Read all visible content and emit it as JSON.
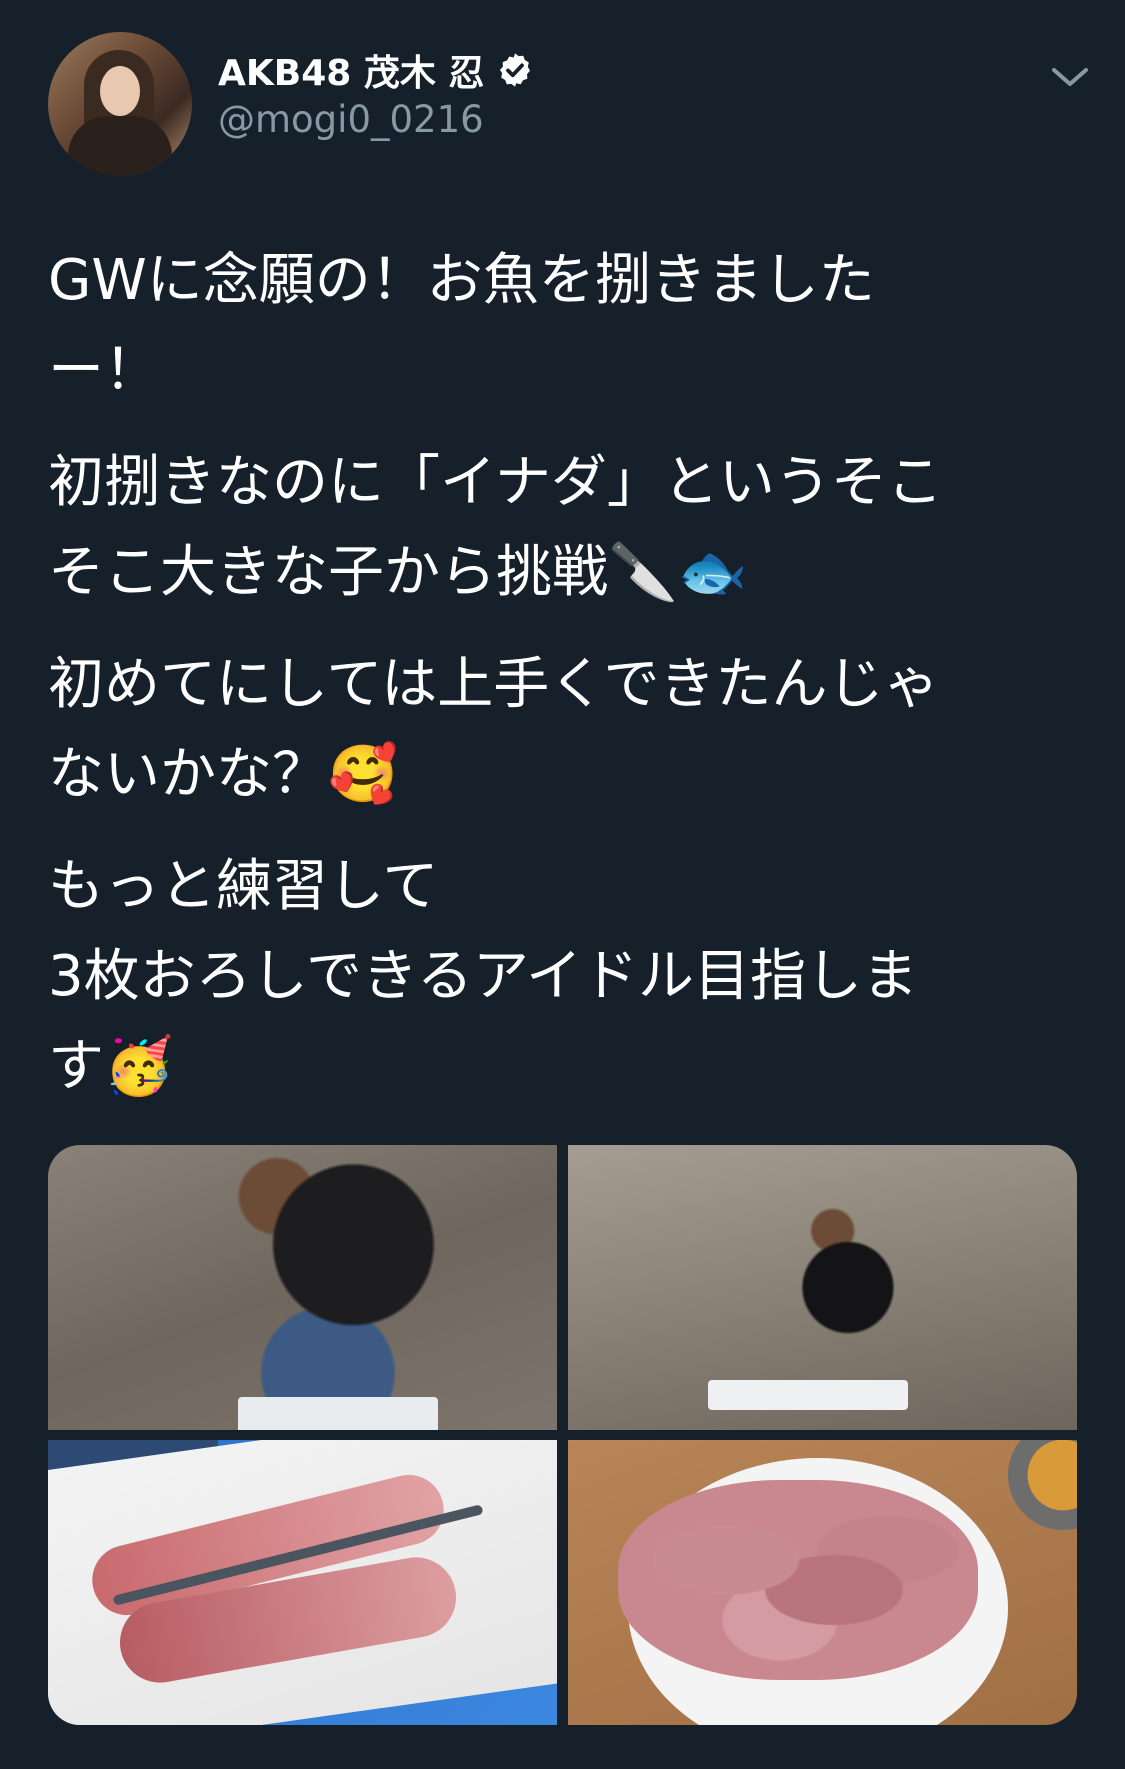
{
  "tweet": {
    "author": {
      "display_name": "AKB48 茂木 忍",
      "handle": "@mogi0_0216",
      "verified": true,
      "avatar_icon": "profile-photo"
    },
    "menu_icon": "chevron-down-icon",
    "text_paragraphs": [
      "GWに念願の！お魚を捌きました\nー！",
      "初捌きなのに「イナダ」というそこ\nそこ大きな子から挑戦🔪🐟",
      "初めてにしては上手くできたんじゃ\nないかな？🥰",
      "もっと練習して\n3枚おろしできるアイドル目指しま\nす🥳"
    ],
    "media": {
      "photos": [
        {
          "name": "photo-woman-cutting-fish-closeup"
        },
        {
          "name": "photo-woman-crouching-cutting-fish"
        },
        {
          "name": "photo-fish-fillets-on-board"
        },
        {
          "name": "photo-sashimi-on-plate"
        }
      ]
    }
  },
  "colors": {
    "background": "#15202b",
    "text": "#ffffff",
    "secondary_text": "#8899a6"
  }
}
